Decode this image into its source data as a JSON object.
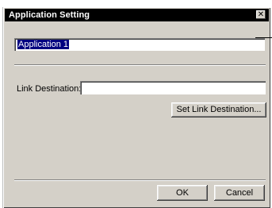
{
  "window": {
    "title": "Application Setting",
    "close_glyph": "✕",
    "close_icon": "close-icon"
  },
  "application_name": {
    "value": "Application 1"
  },
  "link_destination": {
    "label": "Link Destination:",
    "value": ""
  },
  "buttons": {
    "set_link": "Set Link Destination...",
    "ok": "OK",
    "cancel": "Cancel"
  },
  "colors": {
    "titlebar": "#000000",
    "dialog_face": "#d4d0c8",
    "selection": "#000080"
  }
}
